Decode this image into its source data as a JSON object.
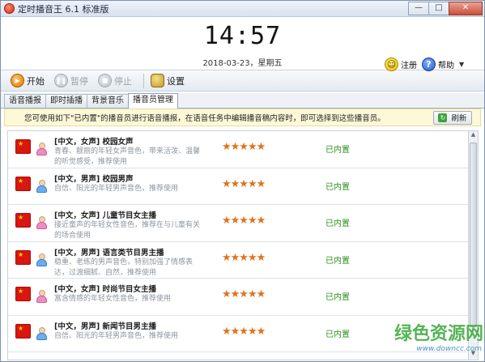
{
  "window": {
    "title": "定时播音王 6.1 标准版",
    "minimize": "—",
    "maximize": "□",
    "close": "✕"
  },
  "header": {
    "time": "14:57",
    "date": "2018-03-23，星期五",
    "register_label": "注册",
    "help_label": "帮助"
  },
  "toolbar": {
    "start_label": "开始",
    "pause_label": "暂停",
    "stop_label": "停止",
    "settings_label": "设置"
  },
  "tabs": [
    {
      "label": "语音播报",
      "active": false
    },
    {
      "label": "即时插播",
      "active": false
    },
    {
      "label": "背景音乐",
      "active": false
    },
    {
      "label": "播音员管理",
      "active": true
    }
  ],
  "info": {
    "text": "您可使用如下\"已内置\"的播音员进行语音播报，在语音任务中编辑播音稿内容时，即可选择到这些播音员。",
    "refresh_label": "刷新"
  },
  "voices": [
    {
      "name": "[中文，女声] 校园女声",
      "gender": "female",
      "desc": "青春、靓丽的年轻女声音色，带来活泼、温馨的听觉感受，推荐使用",
      "rating": 5,
      "status": "已内置"
    },
    {
      "name": "[中文，男声] 校园男声",
      "gender": "male",
      "desc": "自信、阳光的年轻男声音色，推荐使用",
      "rating": 5,
      "status": "已内置"
    },
    {
      "name": "[中文，女声] 儿童节目女主播",
      "gender": "female",
      "desc": "接近童声的年轻女性音色，推荐在与儿童有关的场合使用",
      "rating": 5,
      "status": "已内置"
    },
    {
      "name": "[中文，男声] 语言类节目男主播",
      "gender": "male",
      "desc": "稳重、老练的男声音色，特别加强了情感表达，过渡细腻、自然，推荐使用",
      "rating": 5,
      "status": "已内置"
    },
    {
      "name": "[中文，女声] 时尚节目女主播",
      "gender": "female",
      "desc": "富含情感的年轻女性音色，推荐使用",
      "rating": 5,
      "status": "已内置"
    },
    {
      "name": "[中文，男声] 新闻节目男主播",
      "gender": "male",
      "desc": "自信、阳光的年轻男声音色，推荐使用",
      "rating": 5,
      "status": "已内置"
    }
  ],
  "watermark": {
    "main": "绿色资源网",
    "sub": "www.downcc.com"
  },
  "colors": {
    "accent_green": "#2d8f1b",
    "star_orange": "#e0731b",
    "info_bg": "#fdf8d8"
  }
}
